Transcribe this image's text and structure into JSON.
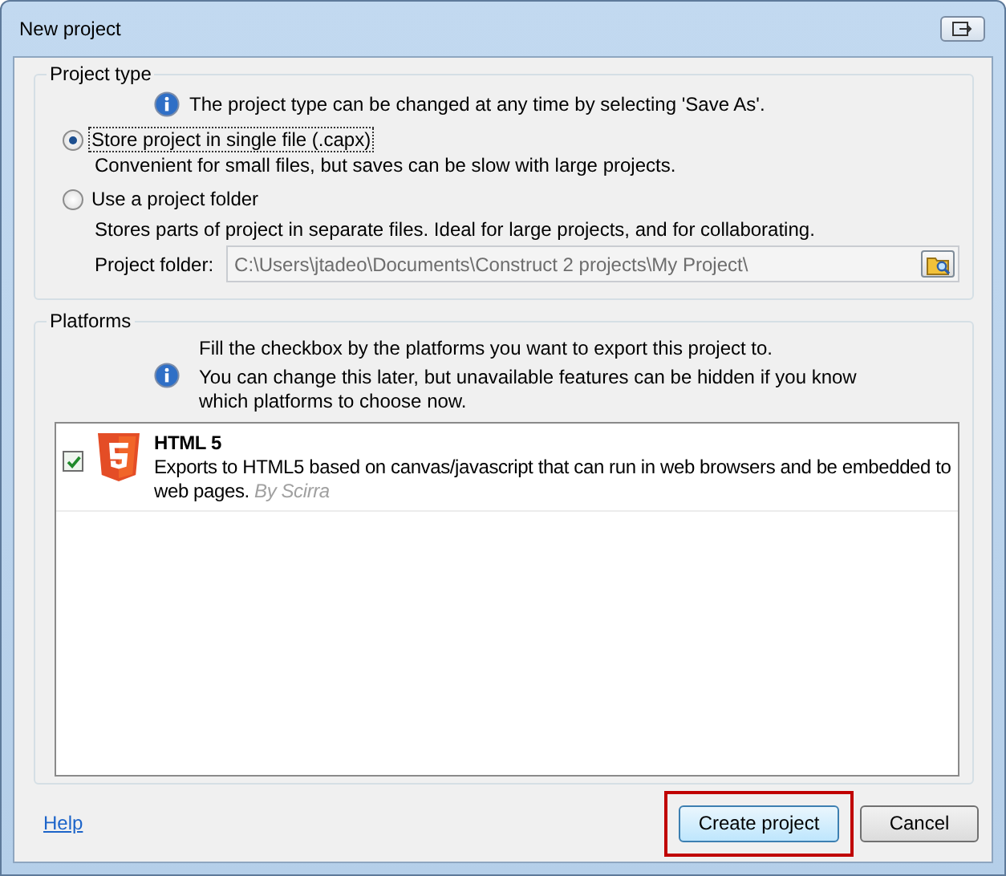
{
  "window": {
    "title": "New project"
  },
  "project_type": {
    "title": "Project type",
    "info": "The project type can be changed at any time by selecting 'Save As'.",
    "options": [
      {
        "label": "Store project in single file (.capx)",
        "description": "Convenient for small files, but saves can be slow with large projects.",
        "selected": true
      },
      {
        "label": "Use a project folder",
        "description": "Stores parts of project in separate files.  Ideal for large projects, and for collaborating.",
        "selected": false
      }
    ],
    "folder": {
      "label": "Project folder:",
      "value": "C:\\Users\\jtadeo\\Documents\\Construct 2 projects\\My Project\\",
      "disabled": true
    }
  },
  "platforms": {
    "title": "Platforms",
    "info": [
      "Fill the checkbox by the platforms you want to export this project to.",
      "You can change this later, but unavailable features can be hidden if you know which platforms to choose now."
    ],
    "items": [
      {
        "name": "HTML 5",
        "description": "Exports to HTML5 based on canvas/javascript that can run in web browsers and be embedded to web pages.",
        "author": "By Scirra",
        "checked": true
      }
    ]
  },
  "footer": {
    "help": "Help",
    "buttons": [
      {
        "label": "Create project",
        "highlighted": true
      },
      {
        "label": "Cancel",
        "highlighted": false
      }
    ]
  }
}
